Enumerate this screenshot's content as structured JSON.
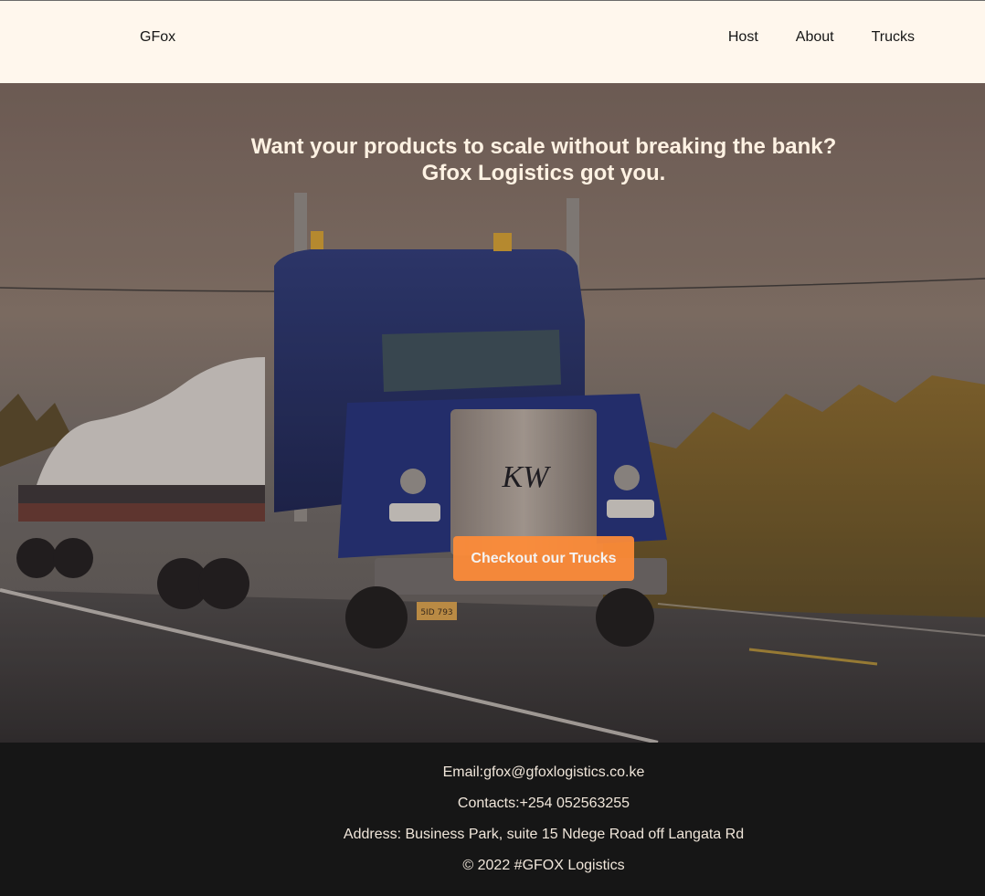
{
  "header": {
    "logo": "GFox",
    "nav": [
      "Host",
      "About",
      "Trucks"
    ]
  },
  "hero": {
    "title_line1": "Want your products to scale without breaking the bank?",
    "title_line2": "Gfox Logistics got you.",
    "cta_label": "Checkout our Trucks",
    "truck_grille_badge": "KW",
    "truck_plate": "5ID 793"
  },
  "footer": {
    "email": "Email:gfox@gfoxlogistics.co.ke",
    "contacts": "Contacts:+254 052563255",
    "address": "Address: Business Park, suite 15 Ndege Road off Langata Rd",
    "copyright": "© 2022 #GFOX Logistics"
  },
  "colors": {
    "header_bg": "#fff7ed",
    "accent": "#ff8c38",
    "footer_bg": "#161616"
  }
}
